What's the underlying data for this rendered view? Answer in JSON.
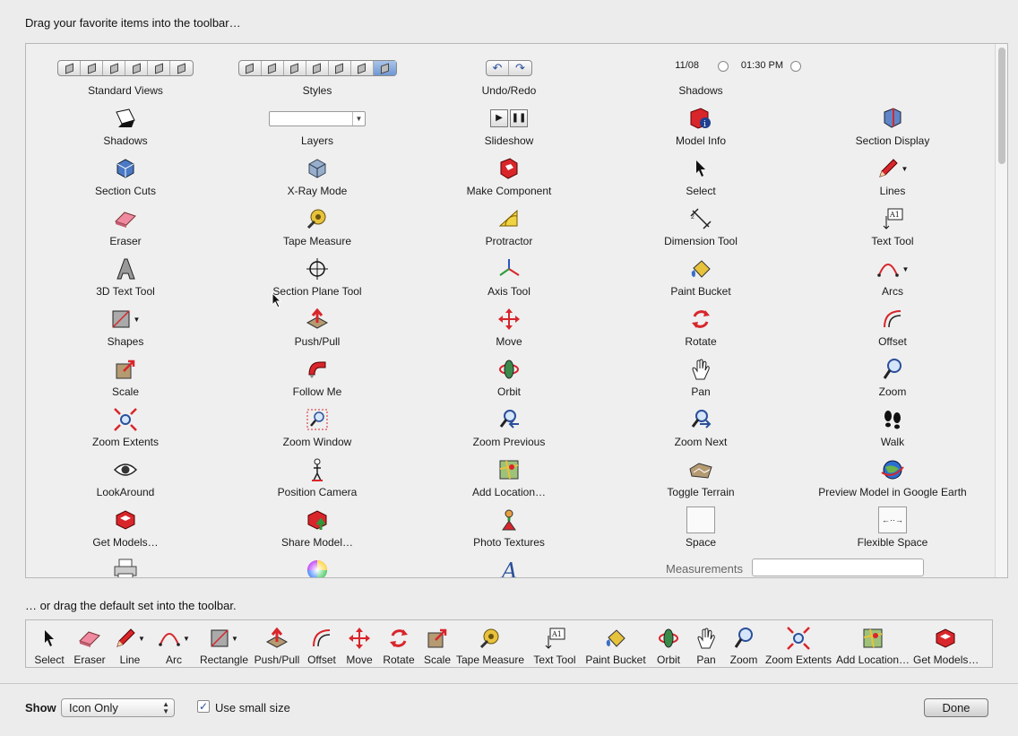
{
  "heading_top": "Drag your favorite items into the toolbar…",
  "heading_bottom": "… or drag the default set into the toolbar.",
  "shadow_date": "11/08",
  "shadow_time": "01:30 PM",
  "measurements_label": "Measurements",
  "items": [
    {
      "label": "Standard Views",
      "icon": "standard-views-icon"
    },
    {
      "label": "Styles",
      "icon": "styles-icon"
    },
    {
      "label": "Undo/Redo",
      "icon": "undo-redo-icon"
    },
    {
      "label": "Shadows",
      "icon": "shadow-sliders-icon"
    },
    {
      "label": "",
      "icon": ""
    },
    {
      "label": "Shadows",
      "icon": "shadows-icon"
    },
    {
      "label": "Layers",
      "icon": "layers-dropdown-icon"
    },
    {
      "label": "Slideshow",
      "icon": "slideshow-icon"
    },
    {
      "label": "Model Info",
      "icon": "model-info-icon"
    },
    {
      "label": "Section Display",
      "icon": "section-display-icon"
    },
    {
      "label": "Section Cuts",
      "icon": "section-cuts-icon"
    },
    {
      "label": "X-Ray Mode",
      "icon": "x-ray-icon"
    },
    {
      "label": "Make Component",
      "icon": "make-component-icon"
    },
    {
      "label": "Select",
      "icon": "select-arrow-icon"
    },
    {
      "label": "Lines",
      "icon": "pencil-icon"
    },
    {
      "label": "Eraser",
      "icon": "eraser-icon"
    },
    {
      "label": "Tape Measure",
      "icon": "tape-measure-icon"
    },
    {
      "label": "Protractor",
      "icon": "protractor-icon"
    },
    {
      "label": "Dimension Tool",
      "icon": "dimension-icon"
    },
    {
      "label": "Text Tool",
      "icon": "text-tool-icon"
    },
    {
      "label": "3D Text Tool",
      "icon": "3d-text-icon"
    },
    {
      "label": "Section Plane Tool",
      "icon": "section-plane-icon"
    },
    {
      "label": "Axis Tool",
      "icon": "axis-icon"
    },
    {
      "label": "Paint Bucket",
      "icon": "paint-bucket-icon"
    },
    {
      "label": "Arcs",
      "icon": "arc-icon"
    },
    {
      "label": "Shapes",
      "icon": "rectangle-icon"
    },
    {
      "label": "Push/Pull",
      "icon": "push-pull-icon"
    },
    {
      "label": "Move",
      "icon": "move-icon"
    },
    {
      "label": "Rotate",
      "icon": "rotate-icon"
    },
    {
      "label": "Offset",
      "icon": "offset-icon"
    },
    {
      "label": "Scale",
      "icon": "scale-icon"
    },
    {
      "label": "Follow Me",
      "icon": "follow-me-icon"
    },
    {
      "label": "Orbit",
      "icon": "orbit-icon"
    },
    {
      "label": "Pan",
      "icon": "hand-icon"
    },
    {
      "label": "Zoom",
      "icon": "magnifier-icon"
    },
    {
      "label": "Zoom Extents",
      "icon": "zoom-extents-icon"
    },
    {
      "label": "Zoom Window",
      "icon": "zoom-window-icon"
    },
    {
      "label": "Zoom Previous",
      "icon": "zoom-previous-icon"
    },
    {
      "label": "Zoom Next",
      "icon": "zoom-next-icon"
    },
    {
      "label": "Walk",
      "icon": "footprints-icon"
    },
    {
      "label": "LookAround",
      "icon": "eye-icon"
    },
    {
      "label": "Position Camera",
      "icon": "position-camera-icon"
    },
    {
      "label": "Add Location…",
      "icon": "add-location-icon"
    },
    {
      "label": "Toggle Terrain",
      "icon": "terrain-icon"
    },
    {
      "label": "Preview Model in Google Earth",
      "icon": "google-earth-icon"
    },
    {
      "label": "Get Models…",
      "icon": "get-models-icon"
    },
    {
      "label": "Share Model…",
      "icon": "share-model-icon"
    },
    {
      "label": "Photo Textures",
      "icon": "photo-textures-icon"
    },
    {
      "label": "Space",
      "icon": "space-icon"
    },
    {
      "label": "Flexible Space",
      "icon": "flexible-space-icon"
    },
    {
      "label": "",
      "icon": "printer-icon"
    },
    {
      "label": "",
      "icon": "color-wheel-icon"
    },
    {
      "label": "",
      "icon": "fonts-icon"
    }
  ],
  "default_set": [
    {
      "label": "Select",
      "icon": "select-arrow-icon"
    },
    {
      "label": "Eraser",
      "icon": "eraser-icon"
    },
    {
      "label": "Line",
      "icon": "pencil-icon"
    },
    {
      "label": "Arc",
      "icon": "arc-icon"
    },
    {
      "label": "Rectangle",
      "icon": "rectangle-icon"
    },
    {
      "label": "Push/Pull",
      "icon": "push-pull-icon"
    },
    {
      "label": "Offset",
      "icon": "offset-icon"
    },
    {
      "label": "Move",
      "icon": "move-icon"
    },
    {
      "label": "Rotate",
      "icon": "rotate-icon"
    },
    {
      "label": "Scale",
      "icon": "scale-icon"
    },
    {
      "label": "Tape Measure",
      "icon": "tape-measure-icon"
    },
    {
      "label": "Text Tool",
      "icon": "text-tool-icon"
    },
    {
      "label": "Paint Bucket",
      "icon": "paint-bucket-icon"
    },
    {
      "label": "Orbit",
      "icon": "orbit-icon"
    },
    {
      "label": "Pan",
      "icon": "hand-icon"
    },
    {
      "label": "Zoom",
      "icon": "magnifier-icon"
    },
    {
      "label": "Zoom Extents",
      "icon": "zoom-extents-icon"
    },
    {
      "label": "Add Location…",
      "icon": "add-location-icon"
    },
    {
      "label": "Get Models…",
      "icon": "get-models-icon"
    }
  ],
  "show_label": "Show",
  "show_value": "Icon Only",
  "small_size_label": "Use small size",
  "small_size_checked": true,
  "done_label": "Done",
  "colors": {
    "accent_red": "#d8262b",
    "accent_blue": "#3a6fc4",
    "highlight": "#7a9fd8"
  }
}
